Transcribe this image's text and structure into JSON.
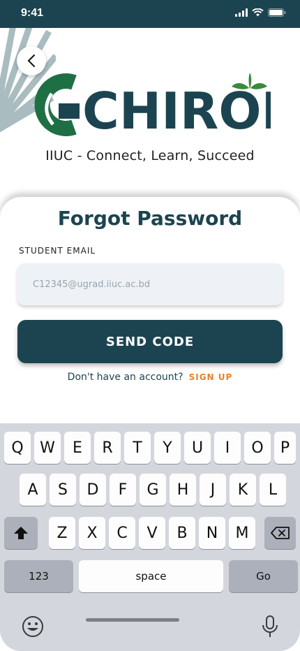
{
  "status_bar": {
    "time": "9:41"
  },
  "brand": {
    "logo_text": "CHIROKUT",
    "tagline": "IIUC - Connect, Learn, Succeed"
  },
  "form": {
    "title": "Forgot Password",
    "email_label": "STUDENT EMAIL",
    "email_placeholder": "C12345@ugrad.iiuc.ac.bd",
    "email_value": "",
    "submit_label": "SEND CODE",
    "account_prompt": "Don't have an account?",
    "signup_link": "SIGN UP"
  },
  "keyboard": {
    "row1": [
      "Q",
      "W",
      "E",
      "R",
      "T",
      "Y",
      "U",
      "I",
      "O",
      "P"
    ],
    "row2": [
      "A",
      "S",
      "D",
      "F",
      "G",
      "H",
      "J",
      "K",
      "L"
    ],
    "row3": [
      "Z",
      "X",
      "C",
      "V",
      "B",
      "N",
      "M"
    ],
    "numbers_key": "123",
    "space_key": "space",
    "go_key": "Go"
  },
  "colors": {
    "primary": "#1c4450",
    "accent": "#e8822a",
    "leaf": "#3a8a3a",
    "input_bg": "#eef2f7",
    "keyboard_bg": "#d3d6dc"
  },
  "icons": [
    "back-icon",
    "signal-icon",
    "wifi-icon",
    "battery-icon",
    "shift-icon",
    "backspace-icon",
    "emoji-icon",
    "microphone-icon"
  ]
}
